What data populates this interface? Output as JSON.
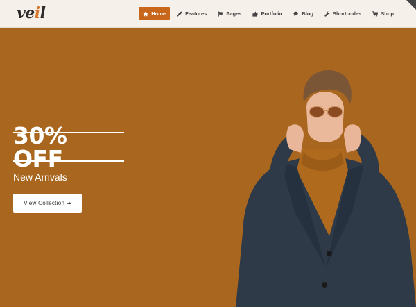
{
  "brand": {
    "logo_text": "ve",
    "logo_accent": "i",
    "logo_tail": "l"
  },
  "nav": {
    "items": [
      {
        "label": "Home",
        "icon": "home-icon",
        "active": true
      },
      {
        "label": "Features",
        "icon": "rocket-icon",
        "active": false
      },
      {
        "label": "Pages",
        "icon": "flag-icon",
        "active": false
      },
      {
        "label": "Portfolio",
        "icon": "thumbs-up-icon",
        "active": false
      },
      {
        "label": "Blog",
        "icon": "comments-icon",
        "active": false
      },
      {
        "label": "Shortcodes",
        "icon": "wrench-icon",
        "active": false
      },
      {
        "label": "Shop",
        "icon": "cart-icon",
        "active": false
      }
    ]
  },
  "hero": {
    "promo": "30% OFF",
    "subtitle": "New Arrivals",
    "cta_label": "View Collection ➞"
  },
  "colors": {
    "background": "#a8661f",
    "accent": "#c8661b",
    "topbar": "#f6f0ea"
  }
}
